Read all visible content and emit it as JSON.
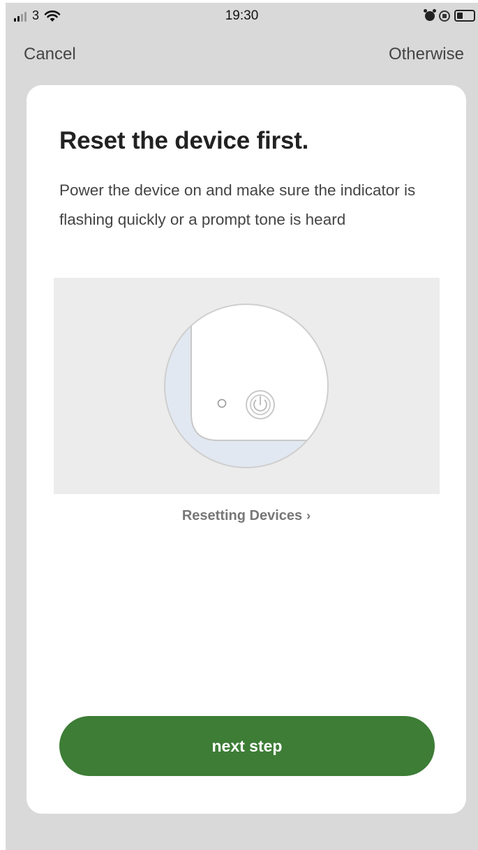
{
  "status_bar": {
    "carrier": "3",
    "time": "19:30",
    "icons": [
      "signal-icon",
      "wifi-icon",
      "alarm-icon",
      "rotation-lock-icon",
      "battery-icon"
    ]
  },
  "nav": {
    "cancel_label": "Cancel",
    "otherwise_label": "Otherwise"
  },
  "card": {
    "title": "Reset the device first.",
    "description": "Power the device on and make sure the indicator is flashing quickly or a prompt tone is heard",
    "illustration_icon": "device-power-button-icon",
    "resetting_link": "Resetting Devices",
    "resetting_link_icon": "chevron-right-icon",
    "next_label": "next step"
  },
  "colors": {
    "background": "#d9d9d9",
    "card": "#ffffff",
    "primary_button": "#3d7d36",
    "illustration_bg": "#ececec",
    "illustration_accent": "#e2e8f1"
  }
}
